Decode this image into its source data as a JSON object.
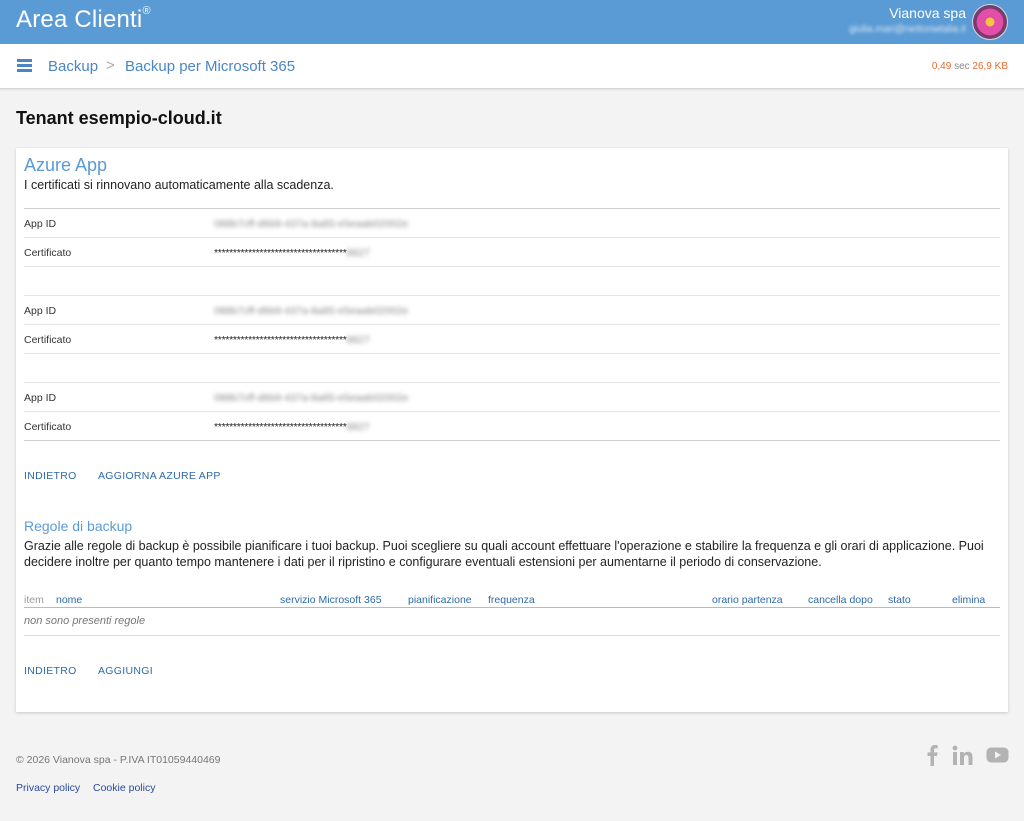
{
  "header": {
    "app_title": "Area Clienti",
    "registered": "®",
    "company": "Vianova spa",
    "user_email": "giulia.mari@nettoriwtalia.it"
  },
  "breadcrumb": {
    "items": [
      "Backup",
      "Backup per Microsoft 365"
    ],
    "separator": ">"
  },
  "perf": {
    "time_value": "0,49",
    "time_unit": "sec",
    "size": "26,9 KB"
  },
  "page_title": "Tenant esempio-cloud.it",
  "azure": {
    "title": "Azure App",
    "subtitle": "I certificati si rinnovano automaticamente alla scadenza.",
    "app_id_label": "App ID",
    "cert_label": "Certificato",
    "entries": [
      {
        "app_id": "088b7cff-d6b9-437a-8a85-e5eaab02002e",
        "cert_mask": "***********************************",
        "cert_tail": "8827"
      },
      {
        "app_id": "088b7cff-d6b9-437a-8a85-e5eaab02002e",
        "cert_mask": "***********************************",
        "cert_tail": "8827"
      },
      {
        "app_id": "088b7cff-d6b9-437a-8a85-e5eaab02002e",
        "cert_mask": "***********************************",
        "cert_tail": "8827"
      }
    ],
    "back_label": "INDIETRO",
    "update_label": "AGGIORNA AZURE APP"
  },
  "rules": {
    "title": "Regole di backup",
    "description": "Grazie alle regole di backup è possibile pianificare i tuoi backup. Puoi scegliere su quali account effettuare l'operazione e stabilire la frequenza e gli orari di applicazione. Puoi decidere inoltre per quanto tempo mantenere i dati per il ripristino e configurare eventuali estensioni per aumentarne il periodo di conservazione.",
    "columns": [
      "item",
      "nome",
      "servizio Microsoft 365",
      "pianificazione",
      "frequenza",
      "orario partenza",
      "cancella dopo",
      "stato",
      "elimina"
    ],
    "empty_text": "non sono presenti regole",
    "back_label": "INDIETRO",
    "add_label": "AGGIUNGI"
  },
  "footer": {
    "copyright": "© 2026 Vianova spa - P.IVA IT01059440469",
    "privacy": "Privacy policy",
    "cookie": "Cookie policy",
    "social_icons": [
      "facebook-icon",
      "linkedin-icon",
      "youtube-icon"
    ]
  },
  "colors": {
    "accent": "#5b9bd5",
    "link": "#2d6aa8",
    "perf_highlight": "#e46d2d"
  }
}
